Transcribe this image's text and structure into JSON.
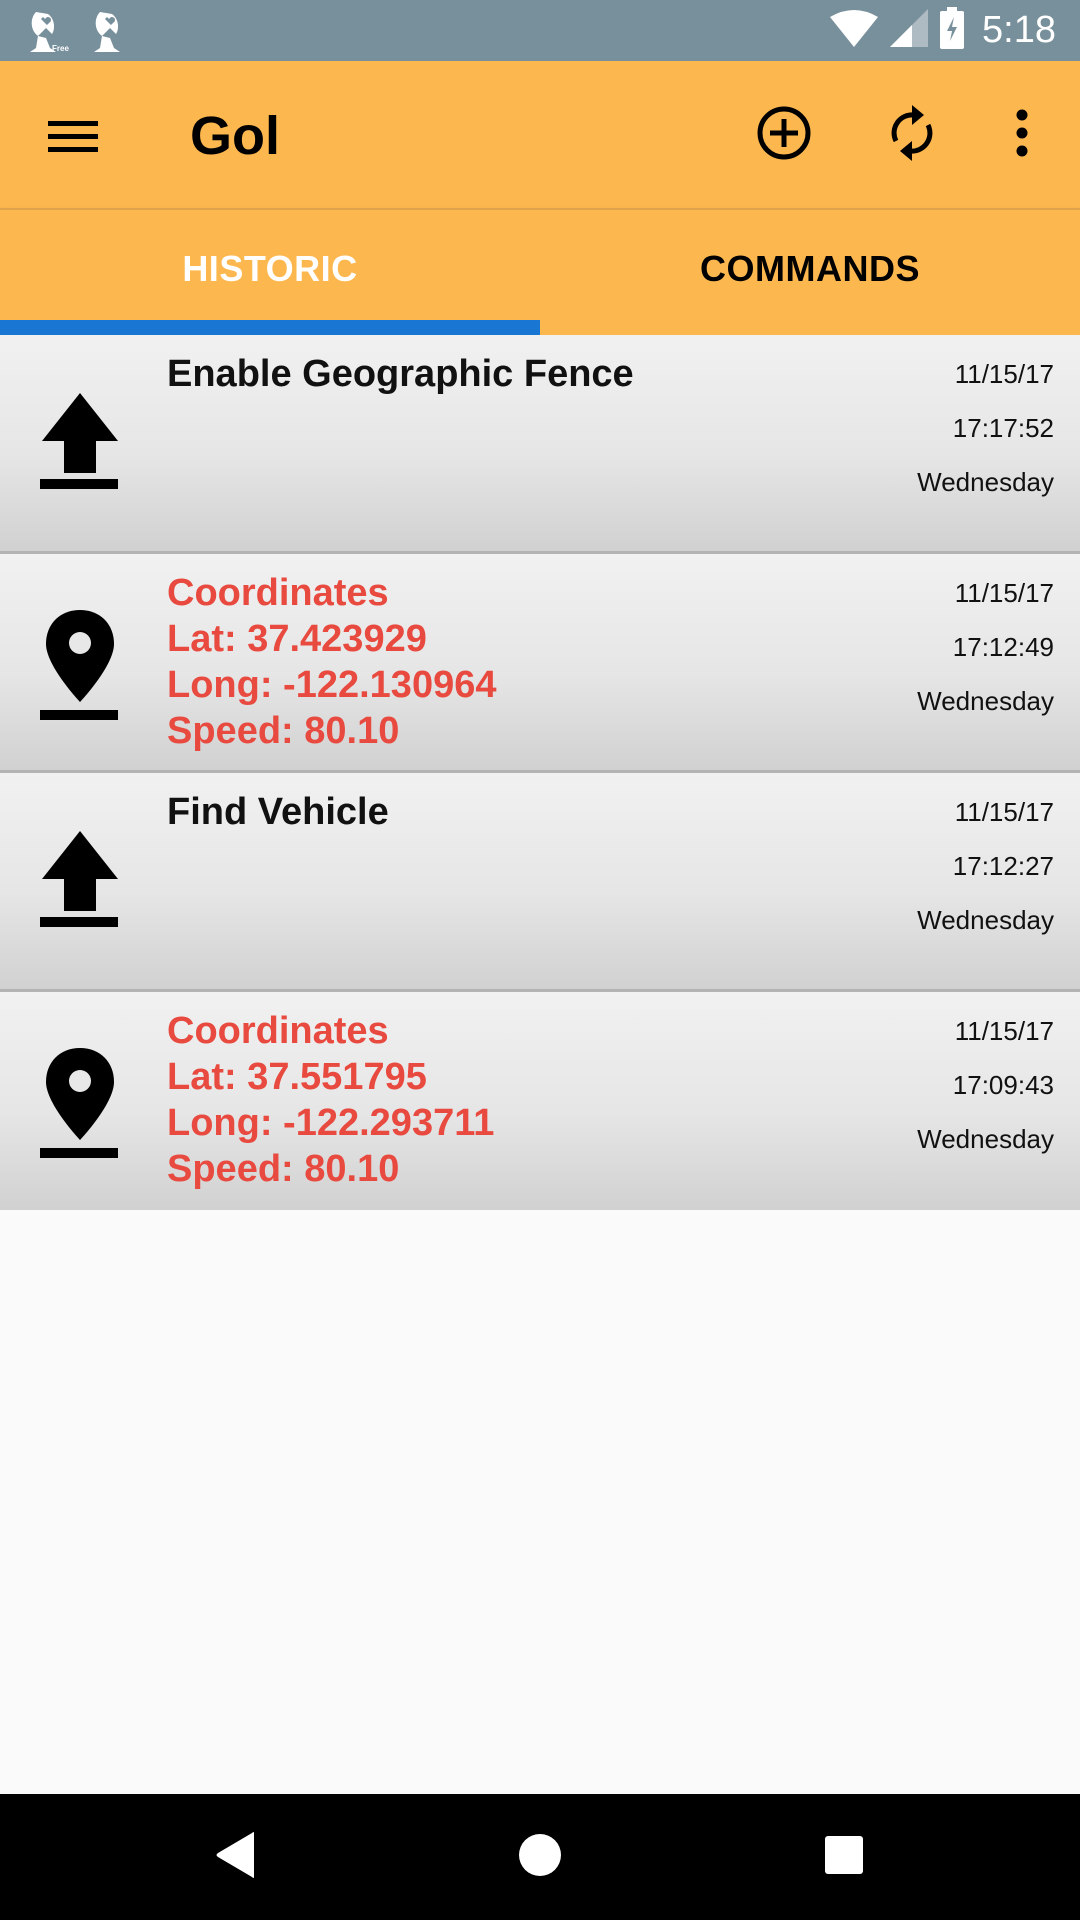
{
  "status_bar": {
    "notifications": [
      {
        "icon": "satellite-dish-free-icon",
        "badge": "Free"
      },
      {
        "icon": "satellite-dish-icon"
      }
    ],
    "wifi_icon": "wifi-icon",
    "signal_icon": "cell-signal-icon",
    "battery_icon": "battery-charging-icon",
    "time": "5:18"
  },
  "toolbar": {
    "menu_icon": "hamburger-menu-icon",
    "title": "Gol",
    "actions": [
      {
        "name": "add",
        "icon": "add-circle-icon"
      },
      {
        "name": "refresh",
        "icon": "refresh-icon"
      },
      {
        "name": "more",
        "icon": "more-vert-icon"
      }
    ],
    "background_color": "#fdb74f"
  },
  "tabs": [
    {
      "label": "HISTORIC",
      "active": true
    },
    {
      "label": "COMMANDS",
      "active": false
    }
  ],
  "tab_indicator_color": "#1976d2",
  "history": [
    {
      "type": "command",
      "icon": "upload-icon",
      "title": "Enable Geographic Fence",
      "date": "11/15/17",
      "time": "17:17:52",
      "day": "Wednesday"
    },
    {
      "type": "coordinates",
      "icon": "location-pin-icon",
      "title": "Coordinates",
      "lat": "Lat: 37.423929",
      "long": "Long: -122.130964",
      "speed": "Speed: 80.10",
      "date": "11/15/17",
      "time": "17:12:49",
      "day": "Wednesday"
    },
    {
      "type": "command",
      "icon": "upload-icon",
      "title": "Find Vehicle",
      "date": "11/15/17",
      "time": "17:12:27",
      "day": "Wednesday"
    },
    {
      "type": "coordinates",
      "icon": "location-pin-icon",
      "title": "Coordinates",
      "lat": "Lat: 37.551795",
      "long": "Long: -122.293711",
      "speed": "Speed: 80.10",
      "date": "11/15/17",
      "time": "17:09:43",
      "day": "Wednesday"
    }
  ],
  "coordinate_text_color": "#e84a3f",
  "nav_bar": {
    "back": "back-icon",
    "home": "home-icon",
    "recents": "recents-icon"
  }
}
